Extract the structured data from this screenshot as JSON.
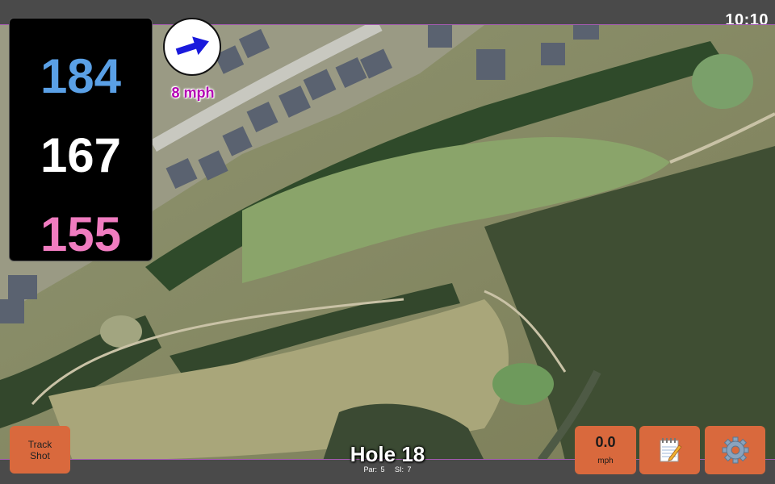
{
  "status": {
    "time": "10:10"
  },
  "distances": {
    "back": "184",
    "middle": "167",
    "front": "155"
  },
  "wind": {
    "speed_label": "8 mph",
    "icon": "wind-arrow-icon"
  },
  "hole": {
    "title": "Hole 18",
    "par_label": "Par: 5",
    "si_label": "SI: 7"
  },
  "buttons": {
    "track_shot_label_line1": "Track",
    "track_shot_label_line2": "Shot",
    "speed_value": "0.0",
    "speed_unit": "mph",
    "notes_icon": "notepad-icon",
    "settings_icon": "gear-icon"
  },
  "colors": {
    "back_distance": "#5aa0e6",
    "middle_distance": "#ffffff",
    "front_distance": "#f07cc0",
    "button": "#d9693d",
    "wind_text": "#b400b4"
  }
}
